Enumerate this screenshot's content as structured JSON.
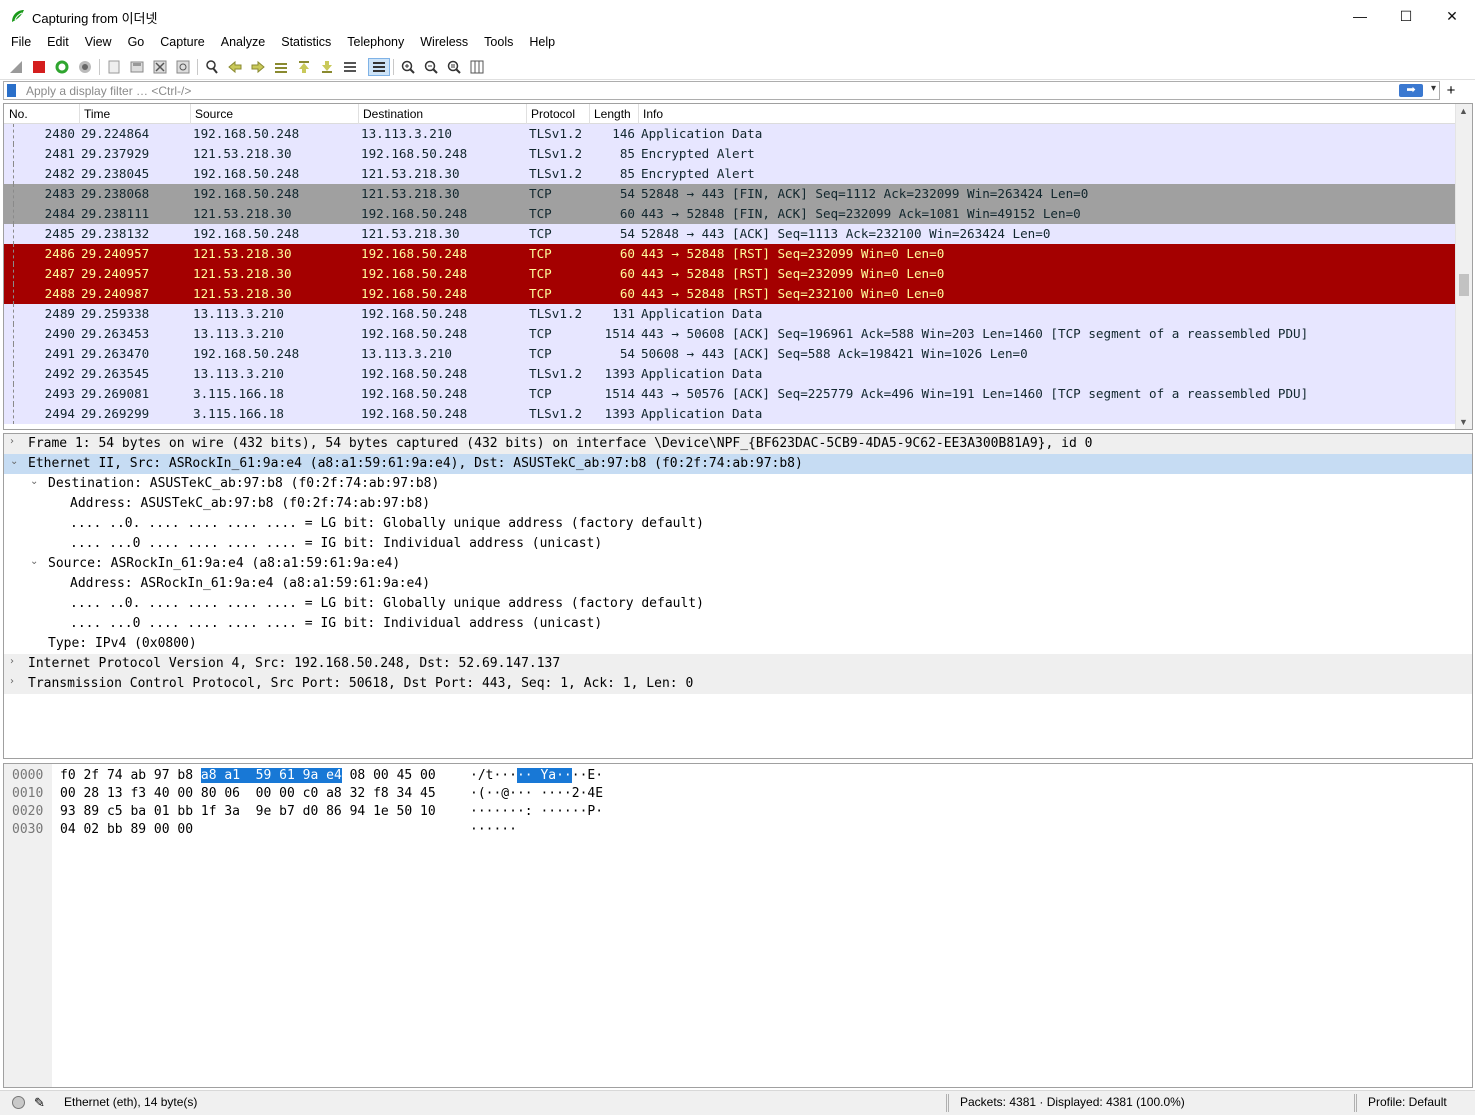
{
  "window": {
    "title": "Capturing from 이더넷",
    "minimize": "—",
    "maximize": "☐",
    "close": "✕"
  },
  "menu": [
    "File",
    "Edit",
    "View",
    "Go",
    "Capture",
    "Analyze",
    "Statistics",
    "Telephony",
    "Wireless",
    "Tools",
    "Help"
  ],
  "filter": {
    "placeholder": "Apply a display filter … <Ctrl-/>",
    "apply_icon": "arrow-right-icon",
    "add_label": "+"
  },
  "packet_list": {
    "columns": [
      "No.",
      "Time",
      "Source",
      "Destination",
      "Protocol",
      "Length",
      "Info"
    ],
    "rows": [
      {
        "no": "2480",
        "time": "29.224864",
        "src": "192.168.50.248",
        "dst": "13.113.3.210",
        "proto": "TLSv1.2",
        "len": "146",
        "info": "Application Data",
        "style": "tls"
      },
      {
        "no": "2481",
        "time": "29.237929",
        "src": "121.53.218.30",
        "dst": "192.168.50.248",
        "proto": "TLSv1.2",
        "len": "85",
        "info": "Encrypted Alert",
        "style": "tls"
      },
      {
        "no": "2482",
        "time": "29.238045",
        "src": "192.168.50.248",
        "dst": "121.53.218.30",
        "proto": "TLSv1.2",
        "len": "85",
        "info": "Encrypted Alert",
        "style": "tls"
      },
      {
        "no": "2483",
        "time": "29.238068",
        "src": "192.168.50.248",
        "dst": "121.53.218.30",
        "proto": "TCP",
        "len": "54",
        "info": "52848 → 443 [FIN, ACK] Seq=1112 Ack=232099 Win=263424 Len=0",
        "style": "gray"
      },
      {
        "no": "2484",
        "time": "29.238111",
        "src": "121.53.218.30",
        "dst": "192.168.50.248",
        "proto": "TCP",
        "len": "60",
        "info": "443 → 52848 [FIN, ACK] Seq=232099 Ack=1081 Win=49152 Len=0",
        "style": "gray"
      },
      {
        "no": "2485",
        "time": "29.238132",
        "src": "192.168.50.248",
        "dst": "121.53.218.30",
        "proto": "TCP",
        "len": "54",
        "info": "52848 → 443 [ACK] Seq=1113 Ack=232100 Win=263424 Len=0",
        "style": "tls"
      },
      {
        "no": "2486",
        "time": "29.240957",
        "src": "121.53.218.30",
        "dst": "192.168.50.248",
        "proto": "TCP",
        "len": "60",
        "info": "443 → 52848 [RST] Seq=232099 Win=0 Len=0",
        "style": "red"
      },
      {
        "no": "2487",
        "time": "29.240957",
        "src": "121.53.218.30",
        "dst": "192.168.50.248",
        "proto": "TCP",
        "len": "60",
        "info": "443 → 52848 [RST] Seq=232099 Win=0 Len=0",
        "style": "red"
      },
      {
        "no": "2488",
        "time": "29.240987",
        "src": "121.53.218.30",
        "dst": "192.168.50.248",
        "proto": "TCP",
        "len": "60",
        "info": "443 → 52848 [RST] Seq=232100 Win=0 Len=0",
        "style": "red"
      },
      {
        "no": "2489",
        "time": "29.259338",
        "src": "13.113.3.210",
        "dst": "192.168.50.248",
        "proto": "TLSv1.2",
        "len": "131",
        "info": "Application Data",
        "style": "tls"
      },
      {
        "no": "2490",
        "time": "29.263453",
        "src": "13.113.3.210",
        "dst": "192.168.50.248",
        "proto": "TCP",
        "len": "1514",
        "info": "443 → 50608 [ACK] Seq=196961 Ack=588 Win=203 Len=1460 [TCP segment of a reassembled PDU]",
        "style": "tls"
      },
      {
        "no": "2491",
        "time": "29.263470",
        "src": "192.168.50.248",
        "dst": "13.113.3.210",
        "proto": "TCP",
        "len": "54",
        "info": "50608 → 443 [ACK] Seq=588 Ack=198421 Win=1026 Len=0",
        "style": "tls"
      },
      {
        "no": "2492",
        "time": "29.263545",
        "src": "13.113.3.210",
        "dst": "192.168.50.248",
        "proto": "TLSv1.2",
        "len": "1393",
        "info": "Application Data",
        "style": "tls"
      },
      {
        "no": "2493",
        "time": "29.269081",
        "src": "3.115.166.18",
        "dst": "192.168.50.248",
        "proto": "TCP",
        "len": "1514",
        "info": "443 → 50576 [ACK] Seq=225779 Ack=496 Win=191 Len=1460 [TCP segment of a reassembled PDU]",
        "style": "tls"
      },
      {
        "no": "2494",
        "time": "29.269299",
        "src": "3.115.166.18",
        "dst": "192.168.50.248",
        "proto": "TLSv1.2",
        "len": "1393",
        "info": "Application Data",
        "style": "tls"
      }
    ]
  },
  "details": [
    {
      "arrow": "›",
      "indent": 0,
      "text": "Frame 1: 54 bytes on wire (432 bits), 54 bytes captured (432 bits) on interface \\Device\\NPF_{BF623DAC-5CB9-4DA5-9C62-EE3A300B81A9}, id 0",
      "style": "top"
    },
    {
      "arrow": "⌄",
      "indent": 0,
      "text": "Ethernet II, Src: ASRockIn_61:9a:e4 (a8:a1:59:61:9a:e4), Dst: ASUSTekC_ab:97:b8 (f0:2f:74:ab:97:b8)",
      "style": "sel"
    },
    {
      "arrow": "⌄",
      "indent": 1,
      "text": "Destination: ASUSTekC_ab:97:b8 (f0:2f:74:ab:97:b8)",
      "style": ""
    },
    {
      "arrow": "",
      "indent": 2,
      "text": "Address: ASUSTekC_ab:97:b8 (f0:2f:74:ab:97:b8)",
      "style": ""
    },
    {
      "arrow": "",
      "indent": 2,
      "text": ".... ..0. .... .... .... .... = LG bit: Globally unique address (factory default)",
      "style": ""
    },
    {
      "arrow": "",
      "indent": 2,
      "text": ".... ...0 .... .... .... .... = IG bit: Individual address (unicast)",
      "style": ""
    },
    {
      "arrow": "⌄",
      "indent": 1,
      "text": "Source: ASRockIn_61:9a:e4 (a8:a1:59:61:9a:e4)",
      "style": ""
    },
    {
      "arrow": "",
      "indent": 2,
      "text": "Address: ASRockIn_61:9a:e4 (a8:a1:59:61:9a:e4)",
      "style": ""
    },
    {
      "arrow": "",
      "indent": 2,
      "text": ".... ..0. .... .... .... .... = LG bit: Globally unique address (factory default)",
      "style": ""
    },
    {
      "arrow": "",
      "indent": 2,
      "text": ".... ...0 .... .... .... .... = IG bit: Individual address (unicast)",
      "style": ""
    },
    {
      "arrow": "",
      "indent": 1,
      "text": "Type: IPv4 (0x0800)",
      "style": ""
    },
    {
      "arrow": "›",
      "indent": 0,
      "text": "Internet Protocol Version 4, Src: 192.168.50.248, Dst: 52.69.147.137",
      "style": "top"
    },
    {
      "arrow": "›",
      "indent": 0,
      "text": "Transmission Control Protocol, Src Port: 50618, Dst Port: 443, Seq: 1, Ack: 1, Len: 0",
      "style": "top"
    }
  ],
  "bytes": [
    {
      "off": "0000",
      "hex_pre": "f0 2f 74 ab 97 b8 ",
      "hex_hl": "a8 a1  59 61 9a e4",
      "hex_post": " 08 00 45 00",
      "asc_pre": "·/t···",
      "asc_hl": "·· Ya··",
      "asc_post": "··E·"
    },
    {
      "off": "0010",
      "hex_pre": "00 28 13 f3 40 00 80 06  00 00 c0 a8 32 f8 34 45",
      "hex_hl": "",
      "hex_post": "",
      "asc_pre": "·(··@··· ····2·4E",
      "asc_hl": "",
      "asc_post": ""
    },
    {
      "off": "0020",
      "hex_pre": "93 89 c5 ba 01 bb 1f 3a  9e b7 d0 86 94 1e 50 10",
      "hex_hl": "",
      "hex_post": "",
      "asc_pre": "·······: ······P·",
      "asc_hl": "",
      "asc_post": ""
    },
    {
      "off": "0030",
      "hex_pre": "04 02 bb 89 00 00",
      "hex_hl": "",
      "hex_post": "",
      "asc_pre": "······",
      "asc_hl": "",
      "asc_post": ""
    }
  ],
  "status": {
    "field": "Ethernet (eth), 14 byte(s)",
    "packets": "Packets: 4381 · Displayed: 4381 (100.0%)",
    "profile": "Profile: Default"
  },
  "colors": {
    "tls_row": "#e7e6ff",
    "gray_row": "#a0a0a0",
    "red_row": "#a40000",
    "red_row_text": "#fffc9c",
    "selected_detail": "#c6dcf3",
    "byte_highlight": "#1878d6"
  }
}
